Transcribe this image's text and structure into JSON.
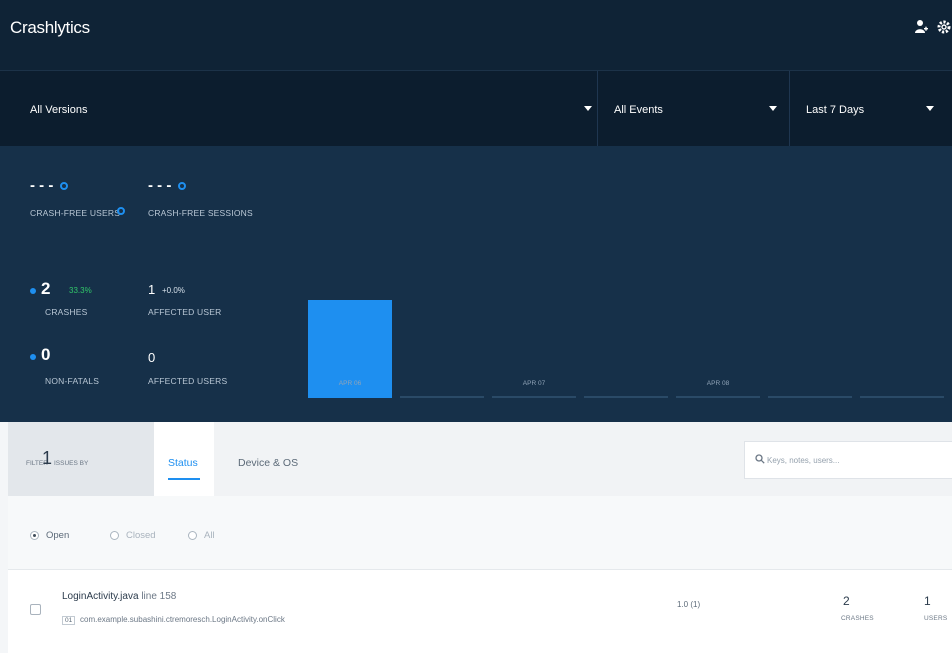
{
  "header": {
    "title": "Crashlytics",
    "icons": [
      "user-add-icon",
      "gear-icon"
    ]
  },
  "filters": {
    "versions": "All Versions",
    "events": "All Events",
    "range": "Last 7 Days"
  },
  "stats": {
    "crash_free_users": {
      "value": "- - -",
      "label": "CRASH-FREE USERS"
    },
    "crash_free_sessions": {
      "value": "- - -",
      "label": "CRASH-FREE SESSIONS"
    },
    "crashes": {
      "value": "2",
      "change": "33.3%",
      "label": "CRASHES"
    },
    "affected_user": {
      "value": "1",
      "change": "+0.0%",
      "label": "AFFECTED USER"
    },
    "non_fatals": {
      "value": "0",
      "label": "NON-FATALS"
    },
    "affected_users": {
      "value": "0",
      "label": "AFFECTED USERS"
    }
  },
  "chart_data": {
    "type": "bar",
    "categories": [
      "APR 06",
      "",
      "APR 07",
      "",
      "APR 08",
      "",
      ""
    ],
    "tick_labels": [
      "APR 06",
      "APR 07",
      "APR 08"
    ],
    "values": [
      2,
      0,
      0,
      0,
      0,
      0,
      0
    ],
    "ylim": [
      0,
      2
    ],
    "grid": false,
    "colors": {
      "bar": "#1e8ff0",
      "baseline": "#2a4a67"
    }
  },
  "toolbar": {
    "filter_label": "FILTER",
    "filter_count": "1",
    "issues_by_label": "ISSUES BY",
    "tabs": [
      {
        "label": "Status",
        "active": true
      },
      {
        "label": "Device & OS",
        "active": false
      }
    ],
    "search_placeholder": "Keys, notes, users..."
  },
  "status_filter": {
    "options": [
      {
        "label": "Open",
        "selected": true
      },
      {
        "label": "Closed",
        "selected": false
      },
      {
        "label": "All",
        "selected": false
      }
    ]
  },
  "issue": {
    "file": "LoginActivity.java",
    "line": "line 158",
    "badge": "01",
    "method": "com.example.subashini.ctremoresch.LoginActivity.onClick",
    "version": "1.0 (1)",
    "crashes_value": "2",
    "crashes_label": "CRASHES",
    "users_value": "1",
    "users_label": "USERS"
  },
  "colors": {
    "accent": "#1e8ff0",
    "topbar": "#0f2336",
    "stats_bg": "#163049",
    "positive": "#31c76a"
  }
}
